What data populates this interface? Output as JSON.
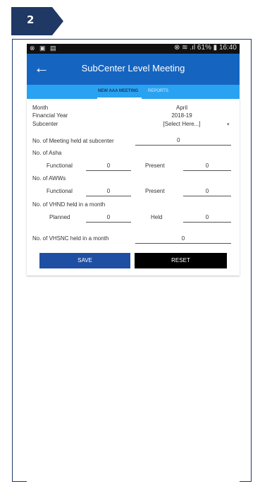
{
  "step": {
    "number": "2"
  },
  "status_bar": {
    "left_icons": "⊗ ▣ ▤",
    "right": "⊗ ≋ .ıl 61% ▮ 16:40"
  },
  "app_bar": {
    "back_icon": "back-arrow-icon",
    "title": "SubCenter Level Meeting"
  },
  "tabs": [
    {
      "label": "NEW AAA MEETING",
      "active": true
    },
    {
      "label": "REPORTS",
      "active": false
    }
  ],
  "form": {
    "month": {
      "label": "Month",
      "value": "April"
    },
    "financial_year": {
      "label": "Financial Year",
      "value": "2018-19"
    },
    "subcenter": {
      "label": "Subcenter",
      "value": "[Select Here...]"
    },
    "meetings_held": {
      "label": "No. of Meeting held at subcenter",
      "value": "0"
    },
    "asha": {
      "label": "No. of Asha",
      "functional_label": "Functional",
      "functional_value": "0",
      "present_label": "Present",
      "present_value": "0"
    },
    "awws": {
      "label": "No. of AWWs",
      "functional_label": "Functional",
      "functional_value": "0",
      "present_label": "Present",
      "present_value": "0"
    },
    "vhnd": {
      "label": "No. of VHND held in a month",
      "planned_label": "Planned",
      "planned_value": "0",
      "held_label": "Held",
      "held_value": "0"
    },
    "vhsnc": {
      "label": "No. of VHSNC held in a month",
      "value": "0"
    }
  },
  "buttons": {
    "save": "SAVE",
    "reset": "RESET"
  },
  "colors": {
    "app_bar": "#1565c0",
    "tabs": "#29a3f1",
    "save": "#1f4fa3",
    "reset": "#000000",
    "badge": "#1f3864"
  }
}
